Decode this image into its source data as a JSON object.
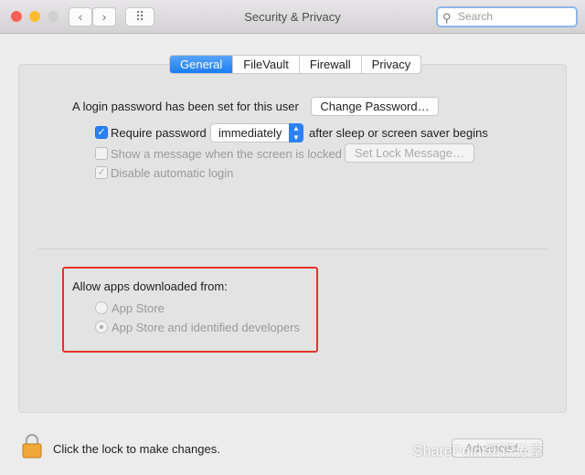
{
  "window": {
    "title": "Security & Privacy",
    "search_placeholder": "Search"
  },
  "toolbar": {
    "back": "‹",
    "forward": "›",
    "grid": "⠿"
  },
  "tabs": [
    {
      "label": "General",
      "active": true
    },
    {
      "label": "FileVault"
    },
    {
      "label": "Firewall"
    },
    {
      "label": "Privacy"
    }
  ],
  "general": {
    "login_text": "A login password has been set for this user",
    "change_password": "Change Password…",
    "require_password": {
      "label": "Require password",
      "checked": true,
      "value": "immediately",
      "suffix": "after sleep or screen saver begins"
    },
    "show_message": {
      "label": "Show a message when the screen is locked",
      "checked": false,
      "button": "Set Lock Message…"
    },
    "disable_autologin": {
      "label": "Disable automatic login",
      "checked": true
    }
  },
  "allow_apps": {
    "title": "Allow apps downloaded from:",
    "options": [
      {
        "label": "App Store",
        "selected": false
      },
      {
        "label": "App Store and identified developers",
        "selected": true
      }
    ]
  },
  "footer": {
    "lock_text": "Click the lock to make changes.",
    "advanced": "Advanced…"
  },
  "watermark": "SharePoint知识分享",
  "colors": {
    "accent": "#2b82f5",
    "highlight": "#e0322a"
  }
}
